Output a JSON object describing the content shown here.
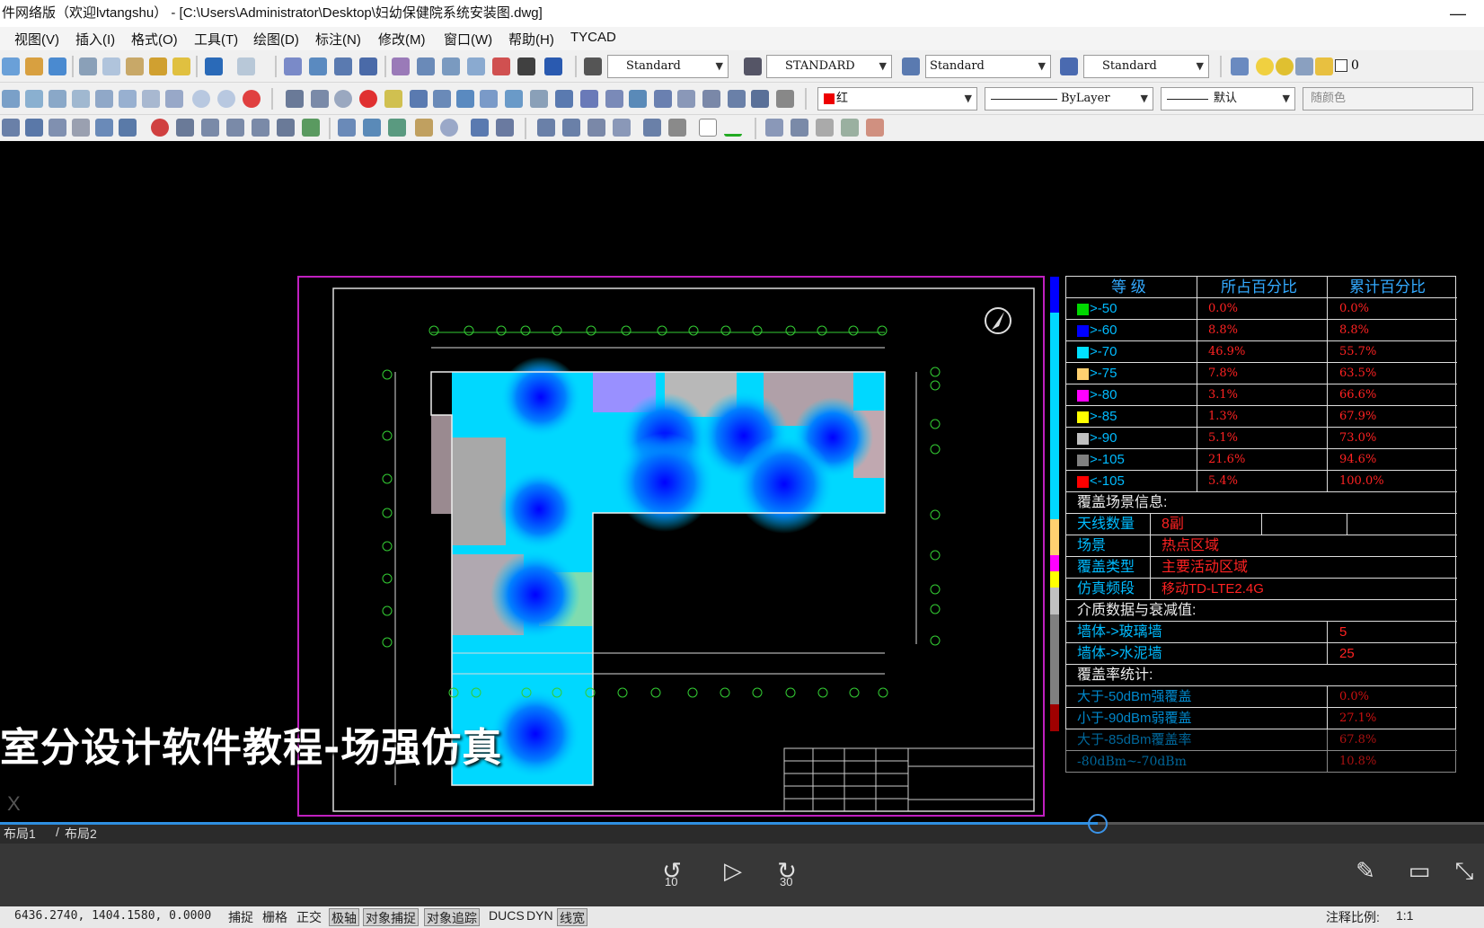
{
  "window": {
    "title": "件网络版（欢迎lvtangshu） - [C:\\Users\\Administrator\\Desktop\\妇幼保健院系统安装图.dwg]"
  },
  "menu": [
    "视图(V)",
    "插入(I)",
    "格式(O)",
    "工具(T)",
    "绘图(D)",
    "标注(N)",
    "修改(M)",
    "窗口(W)",
    "帮助(H)",
    "TYCAD"
  ],
  "toolbar1": {
    "text_style": "Standard",
    "dim_style": "STANDARD",
    "table_style": "Standard",
    "multileader_style": "Standard",
    "layer_value": "0"
  },
  "toolbar2": {
    "color": "红",
    "linetype": "ByLayer",
    "lineweight": "默认",
    "plotstyle": "随颜色"
  },
  "legend": {
    "headers": [
      "等 级",
      "所占百分比",
      "累计百分比"
    ],
    "rows": [
      {
        "level": ">-50",
        "pct": "0.0%",
        "cum": "0.0%",
        "color": "#00d800"
      },
      {
        "level": ">-60",
        "pct": "8.8%",
        "cum": "8.8%",
        "color": "#0000ff"
      },
      {
        "level": ">-70",
        "pct": "46.9%",
        "cum": "55.7%",
        "color": "#00e0ff"
      },
      {
        "level": ">-75",
        "pct": "7.8%",
        "cum": "63.5%",
        "color": "#ffd070"
      },
      {
        "level": ">-80",
        "pct": "3.1%",
        "cum": "66.6%",
        "color": "#ff00ff"
      },
      {
        "level": ">-85",
        "pct": "1.3%",
        "cum": "67.9%",
        "color": "#ffff00"
      },
      {
        "level": ">-90",
        "pct": "5.1%",
        "cum": "73.0%",
        "color": "#c0c0c0"
      },
      {
        "level": ">-105",
        "pct": "21.6%",
        "cum": "94.6%",
        "color": "#808080"
      },
      {
        "level": "<-105",
        "pct": "5.4%",
        "cum": "100.0%",
        "color": "#ff0000"
      }
    ],
    "scene_title": "覆盖场景信息:",
    "scene": [
      {
        "k": "天线数量",
        "v": "8副"
      },
      {
        "k": "场景",
        "v": "热点区域"
      },
      {
        "k": "覆盖类型",
        "v": "主要活动区域"
      },
      {
        "k": "仿真频段",
        "v": "移动TD-LTE2.4G"
      }
    ],
    "media_title": "介质数据与衰减值:",
    "media": [
      {
        "k": "墙体->玻璃墙",
        "v": "5"
      },
      {
        "k": "墙体->水泥墙",
        "v": "25"
      }
    ],
    "stats_title": "覆盖率统计:",
    "stats": [
      {
        "k": "大于-50dBm强覆盖",
        "v": "0.0%"
      },
      {
        "k": "小于-90dBm弱覆盖",
        "v": "27.1%"
      },
      {
        "k": "大于-85dBm覆盖率",
        "v": "67.8%"
      },
      {
        "k": "-80dBm~-70dBm",
        "v": "10.8%"
      }
    ]
  },
  "subtitle": "室分设计软件教程-场强仿真",
  "tabs": [
    "布局1",
    "布局2"
  ],
  "player": {
    "back_seconds": "10",
    "forward_seconds": "30",
    "progress": 0.74
  },
  "status": {
    "coords": "6436.2740, 1404.1580, 0.0000",
    "toggles": [
      "捕捉",
      "栅格",
      "正交",
      "极轴",
      "对象捕捉",
      "对象追踪",
      "DUCS",
      "DYN",
      "线宽"
    ],
    "scale_label": "注释比例:",
    "scale_value": "1:1"
  }
}
